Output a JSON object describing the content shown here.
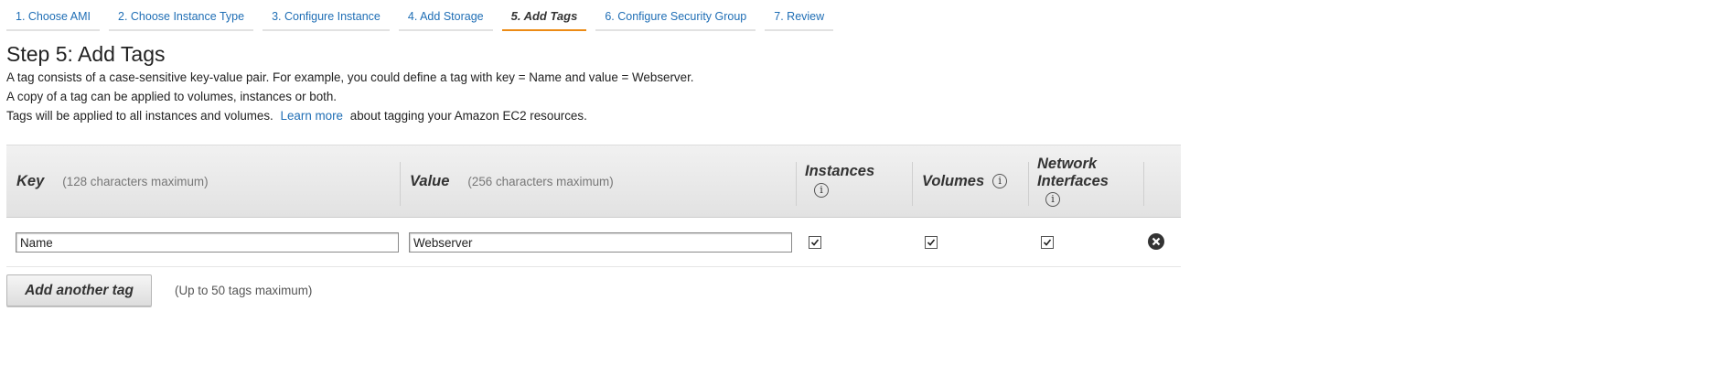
{
  "wizard": {
    "steps": [
      {
        "label": "1. Choose AMI"
      },
      {
        "label": "2. Choose Instance Type"
      },
      {
        "label": "3. Configure Instance"
      },
      {
        "label": "4. Add Storage"
      },
      {
        "label": "5. Add Tags",
        "active": true
      },
      {
        "label": "6. Configure Security Group"
      },
      {
        "label": "7. Review"
      }
    ],
    "accent_color": "#ec8b15",
    "link_color": "#1f6eb5"
  },
  "page": {
    "title": "Step 5: Add Tags",
    "desc_line1": "A tag consists of a case-sensitive key-value pair. For example, you could define a tag with key = Name and value = Webserver.",
    "desc_line2": "A copy of a tag can be applied to volumes, instances or both.",
    "desc_line3_pre": "Tags will be applied to all instances and volumes.",
    "desc_line3_link": "Learn more",
    "desc_line3_post": "about tagging your Amazon EC2 resources."
  },
  "table": {
    "key_header": "Key",
    "key_hint": "(128 characters maximum)",
    "value_header": "Value",
    "value_hint": "(256 characters maximum)",
    "instances_header": "Instances",
    "volumes_header": "Volumes",
    "network_header_1": "Network",
    "network_header_2": "Interfaces",
    "info_icon_glyph": "i",
    "rows": [
      {
        "key": "Name",
        "value": "Webserver",
        "instances": true,
        "volumes": true,
        "network_interfaces": true
      }
    ]
  },
  "actions": {
    "add_label": "Add another tag",
    "add_hint": "(Up to 50 tags maximum)"
  }
}
